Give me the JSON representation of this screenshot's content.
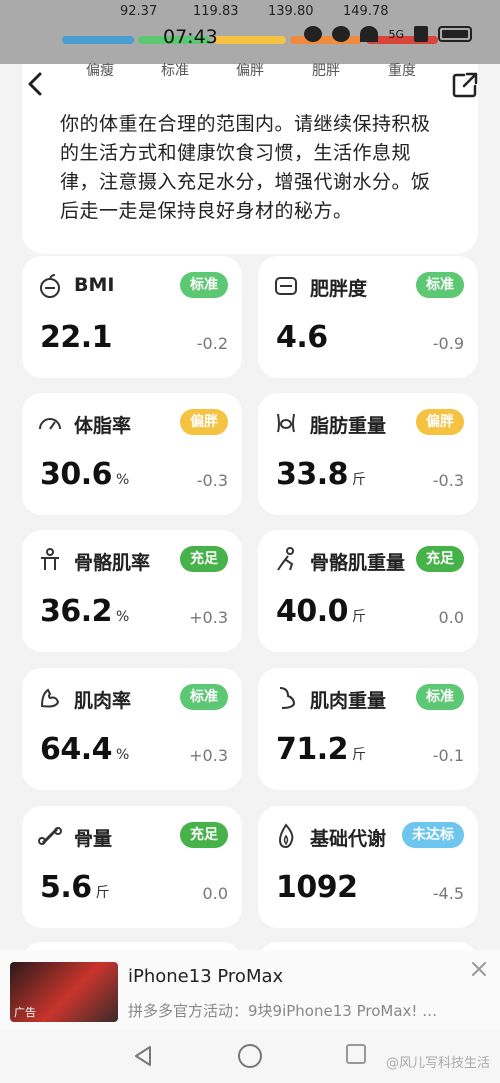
{
  "scale": {
    "thresholds": [
      "92.37",
      "119.83",
      "139.80",
      "149.78"
    ],
    "labels": [
      "偏瘦",
      "标准",
      "偏胖",
      "肥胖",
      "重度"
    ]
  },
  "status_bar": {
    "time": "07:43",
    "network": "5G"
  },
  "advice": {
    "text": "你的体重在合理的范围内。请继续保持积极的生活方式和健康饮食习惯，生活作息规律，注意摄入充足水分，增强代谢水分。饭后走一走是保持良好身材的秘方。"
  },
  "colors": {
    "badge_standard": "#5cc873",
    "badge_fat": "#f5c242",
    "badge_sufficient": "#47b24a",
    "badge_insufficient": "#6cc6ee"
  },
  "metrics": [
    {
      "title": "BMI",
      "icon": "apple-icon",
      "badge": "标准",
      "badge_type": "standard",
      "value": "22.1",
      "unit": "",
      "change": "-0.2"
    },
    {
      "title": "肥胖度",
      "icon": "weight-scale-icon",
      "badge": "标准",
      "badge_type": "standard",
      "value": "4.6",
      "unit": "",
      "change": "-0.9"
    },
    {
      "title": "体脂率",
      "icon": "gauge-icon",
      "badge": "偏胖",
      "badge_type": "fat",
      "value": "30.6",
      "unit": "%",
      "change": "-0.3"
    },
    {
      "title": "脂肪重量",
      "icon": "body-fat-icon",
      "badge": "偏胖",
      "badge_type": "fat",
      "value": "33.8",
      "unit": "斤",
      "change": "-0.3"
    },
    {
      "title": "骨骼肌率",
      "icon": "muscle-body-icon",
      "badge": "充足",
      "badge_type": "sufficient",
      "value": "36.2",
      "unit": "%",
      "change": "+0.3"
    },
    {
      "title": "骨骼肌重量",
      "icon": "running-icon",
      "badge": "充足",
      "badge_type": "sufficient",
      "value": "40.0",
      "unit": "斤",
      "change": "0.0"
    },
    {
      "title": "肌肉率",
      "icon": "bicep-icon",
      "badge": "标准",
      "badge_type": "standard",
      "value": "64.4",
      "unit": "%",
      "change": "+0.3"
    },
    {
      "title": "肌肉重量",
      "icon": "arm-muscle-icon",
      "badge": "标准",
      "badge_type": "standard",
      "value": "71.2",
      "unit": "斤",
      "change": "-0.1"
    },
    {
      "title": "骨量",
      "icon": "bone-icon",
      "badge": "充足",
      "badge_type": "sufficient",
      "value": "5.6",
      "unit": "斤",
      "change": "0.0"
    },
    {
      "title": "基础代谢",
      "icon": "flame-icon",
      "badge": "未达标",
      "badge_type": "insufficient",
      "value": "1092",
      "unit": "",
      "change": "-4.5"
    }
  ],
  "ad": {
    "title": "iPhone13 ProMax",
    "description": "拼多多官方活动：9块9iPhone13 ProMax! …",
    "tag": "广告"
  },
  "watermark": "@风儿写科技生活"
}
